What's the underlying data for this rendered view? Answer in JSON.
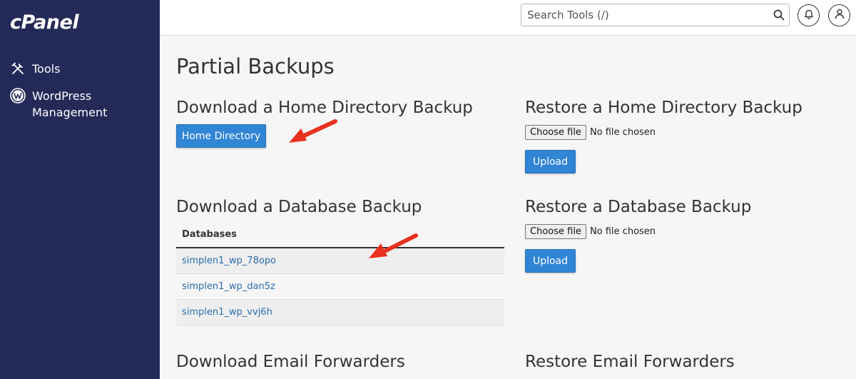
{
  "sidebar": {
    "logo": "cPanel",
    "items": [
      {
        "label": "Tools",
        "icon": "tools-icon"
      },
      {
        "label": "WordPress\nManagement",
        "icon": "wordpress-icon"
      }
    ]
  },
  "topbar": {
    "search_placeholder": "Search Tools (/)"
  },
  "page": {
    "title": "Partial Backups"
  },
  "home_download": {
    "heading": "Download a Home Directory Backup",
    "button_label": "Home Directory"
  },
  "home_restore": {
    "heading": "Restore a Home Directory Backup",
    "choose_label": "Choose file",
    "file_status": "No file chosen",
    "upload_label": "Upload"
  },
  "db_download": {
    "heading": "Download a Database Backup",
    "column_header": "Databases",
    "rows": [
      "simplen1_wp_78opo",
      "simplen1_wp_dan5z",
      "simplen1_wp_vvj6h"
    ]
  },
  "db_restore": {
    "heading": "Restore a Database Backup",
    "choose_label": "Choose file",
    "file_status": "No file chosen",
    "upload_label": "Upload"
  },
  "email_download": {
    "heading": "Download Email Forwarders"
  },
  "email_restore": {
    "heading": "Restore Email Forwarders"
  },
  "colors": {
    "sidebar_bg": "#242a57",
    "primary_button": "#3085d5",
    "link": "#2b6dad",
    "annotation_arrow": "#e8321f"
  }
}
